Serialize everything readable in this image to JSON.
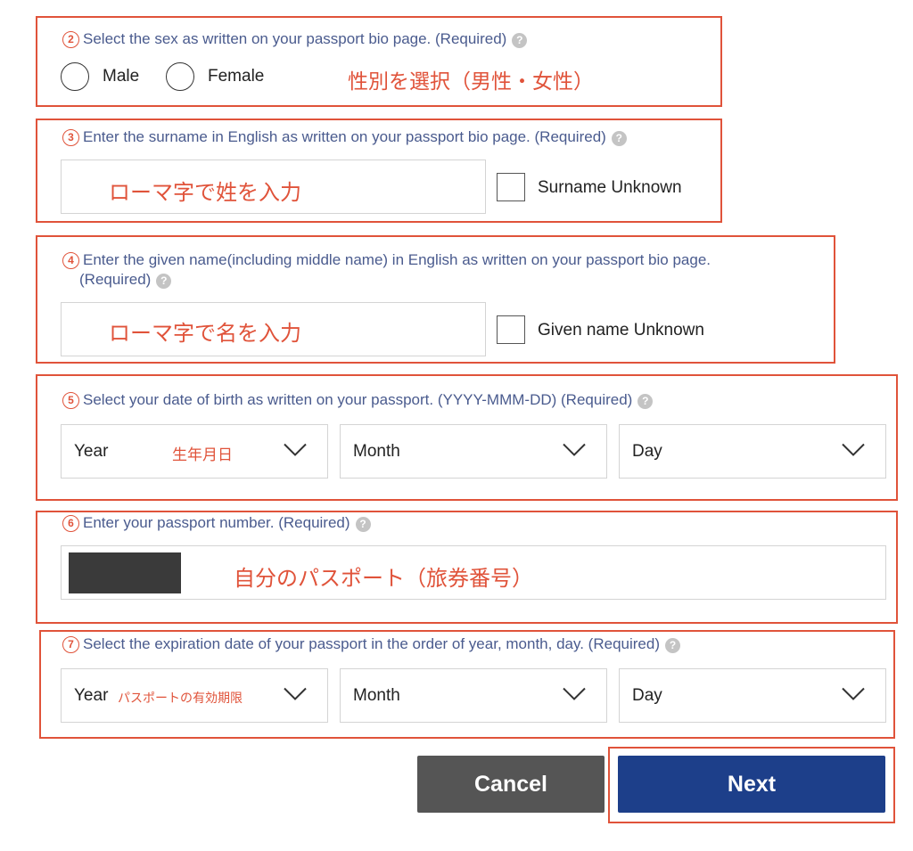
{
  "sex": {
    "number": "2",
    "question": "Select the sex as written on your passport bio page. (Required)",
    "help": "?",
    "options": [
      "Male",
      "Female"
    ],
    "note": "性別を選択（男性・女性）"
  },
  "surname": {
    "number": "3",
    "question": "Enter the surname in English as written on your passport bio page. (Required)",
    "help": "?",
    "note": "ローマ字で姓を入力",
    "checkbox_label": "Surname Unknown"
  },
  "given_name": {
    "number": "4",
    "question_line1": "Enter the given name(including middle name) in English as written on your passport bio page.",
    "question_line2": "(Required)",
    "help": "?",
    "note": "ローマ字で名を入力",
    "checkbox_label": "Given name Unknown"
  },
  "birth": {
    "number": "5",
    "question": "Select your date of birth as written on your passport. (YYYY-MMM-DD) (Required)",
    "help": "?",
    "year": "Year",
    "month": "Month",
    "day": "Day",
    "note": "生年月日"
  },
  "passport": {
    "number": "6",
    "question": "Enter your passport number. (Required)",
    "help": "?",
    "note": "自分のパスポート（旅券番号）"
  },
  "expiry": {
    "number": "7",
    "question": "Select the expiration date of your passport in the order of year, month, day. (Required)",
    "help": "?",
    "year": "Year",
    "month": "Month",
    "day": "Day",
    "note": "パスポートの有効期限"
  },
  "buttons": {
    "cancel": "Cancel",
    "next": "Next"
  },
  "colors": {
    "annotation": "#e0533a",
    "question_text": "#4a5b8e",
    "next_button": "#1d3f8a",
    "cancel_button": "#555555"
  }
}
